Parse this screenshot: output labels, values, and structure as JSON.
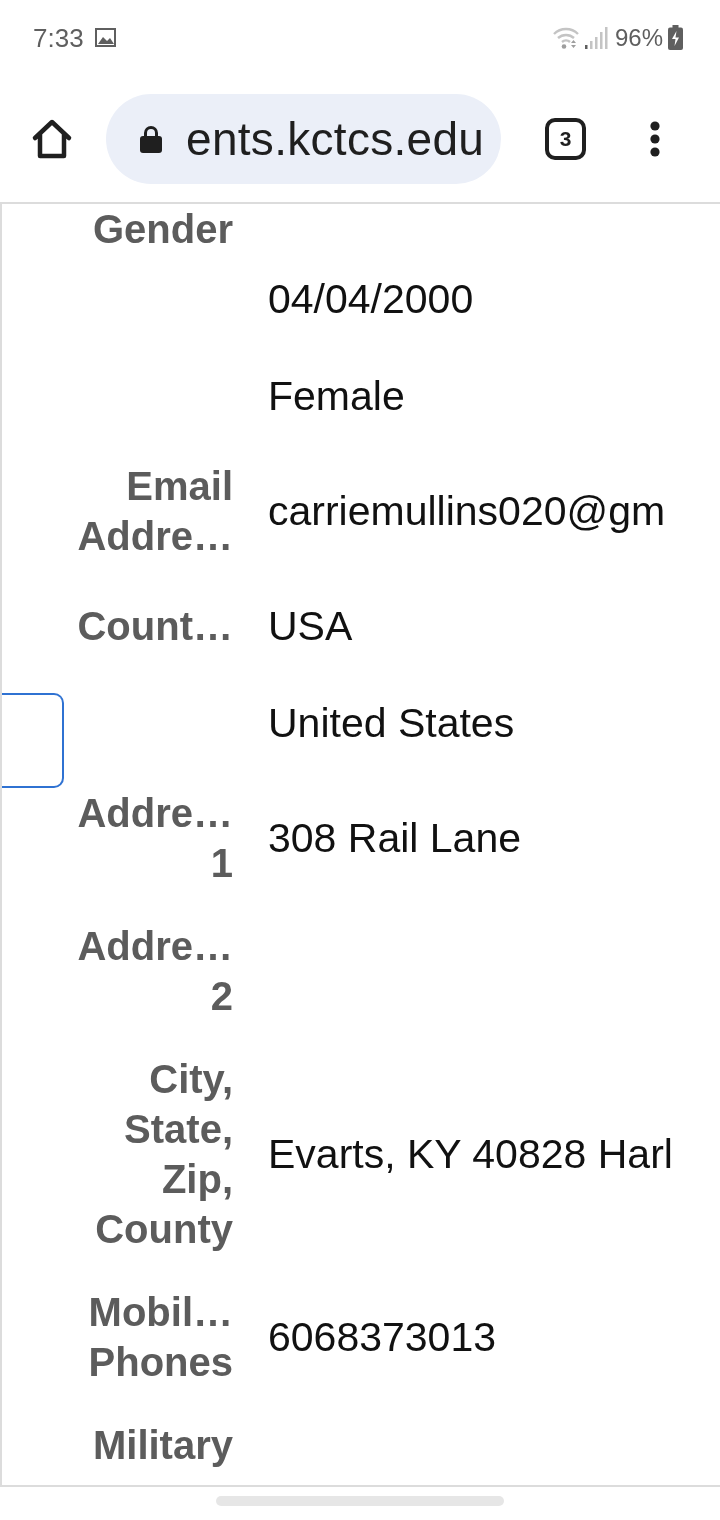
{
  "status_bar": {
    "time": "7:33",
    "battery": "96%"
  },
  "browser_toolbar": {
    "url": "ents.kctcs.edu",
    "tab_count": "3"
  },
  "fields": [
    {
      "label": "Gender"
    },
    {
      "value": "04/04/2000"
    },
    {
      "value": "Female"
    },
    {
      "label": "Email Addre…",
      "value": "carriemullins020@gm"
    },
    {
      "label": "Count…",
      "value": "USA"
    },
    {
      "value": "United States"
    },
    {
      "label": "Addre… 1",
      "value": "308 Rail Lane"
    },
    {
      "label": "Addre… 2"
    },
    {
      "label": "City, State, Zip, County",
      "value": "Evarts, KY 40828 Harl"
    },
    {
      "label": "Mobil… Phones",
      "value": "6068373013"
    },
    {
      "label": "Military"
    }
  ]
}
